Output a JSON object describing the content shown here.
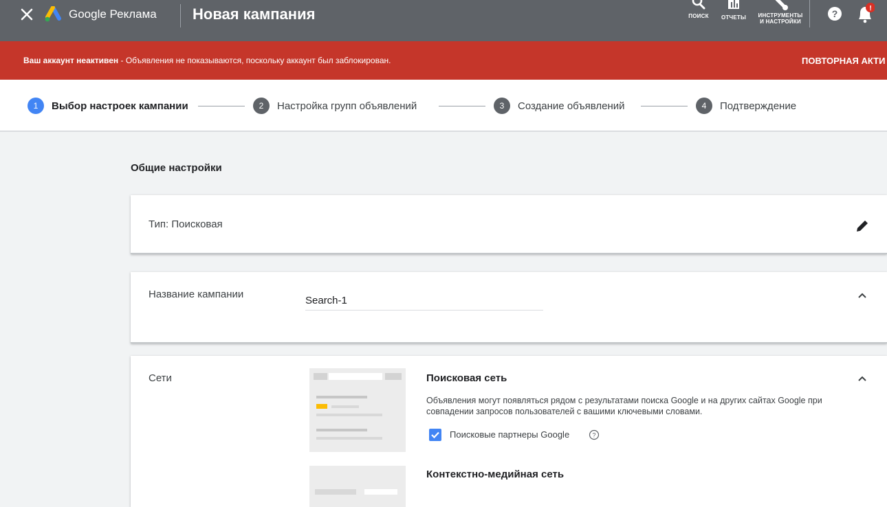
{
  "app": {
    "brand": "Google Реклама",
    "page_title": "Новая кампания"
  },
  "toolbar": {
    "search_label": "ПОИСК",
    "reports_label": "ОТЧЕТЫ",
    "tools_label_line1": "ИНСТРУМЕНТЫ",
    "tools_label_line2": "И НАСТРОЙКИ",
    "notification_badge": "!"
  },
  "banner": {
    "bold_text": "Ваш аккаунт неактивен",
    "message": " - Объявления не показываются, поскольку аккаунт был заблокирован.",
    "action": "ПОВТОРНАЯ АКТИ"
  },
  "stepper": {
    "steps": [
      {
        "num": "1",
        "label": "Выбор настроек кампании"
      },
      {
        "num": "2",
        "label": "Настройка групп объявлений"
      },
      {
        "num": "3",
        "label": "Создание объявлений"
      },
      {
        "num": "4",
        "label": "Подтверждение"
      }
    ]
  },
  "general": {
    "title": "Общие настройки",
    "type_label": "Тип: Поисковая",
    "name_label": "Название кампании",
    "name_value": "Search-1",
    "networks_label": "Сети",
    "search_network": {
      "title": "Поисковая сеть",
      "description": "Объявления могут появляться рядом с результатами поиска Google и на других сайтах Google при совпадении запросов пользователей с вашими ключевыми словами.",
      "partners_label": "Поисковые партнеры Google",
      "partners_checked": true
    },
    "display_network": {
      "title": "Контекстно-медийная сеть"
    }
  },
  "colors": {
    "topbar": "#5f6368",
    "banner": "#c5362a",
    "accent": "#4285f4"
  }
}
